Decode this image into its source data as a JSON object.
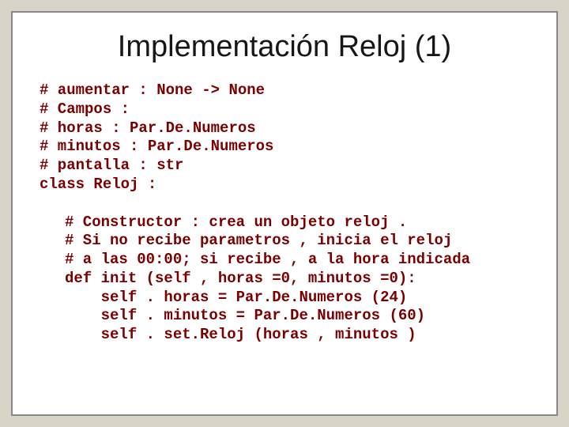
{
  "title": "Implementación Reloj (1)",
  "code": {
    "l1": "# aumentar : None -> None",
    "l2": "# Campos :",
    "l3": "# horas : Par.De.Numeros",
    "l4": "# minutos : Par.De.Numeros",
    "l5": "# pantalla : str",
    "l6": "class Reloj :"
  },
  "code2": {
    "l1": "# Constructor : crea un objeto reloj .",
    "l2": "# Si no recibe parametros , inicia el reloj",
    "l3": "# a las 00:00; si recibe , a la hora indicada",
    "l4": "def init (self , horas =0, minutos =0):",
    "l5": "    self . horas = Par.De.Numeros (24)",
    "l6": "    self . minutos = Par.De.Numeros (60)",
    "l7": "    self . set.Reloj (horas , minutos )"
  }
}
